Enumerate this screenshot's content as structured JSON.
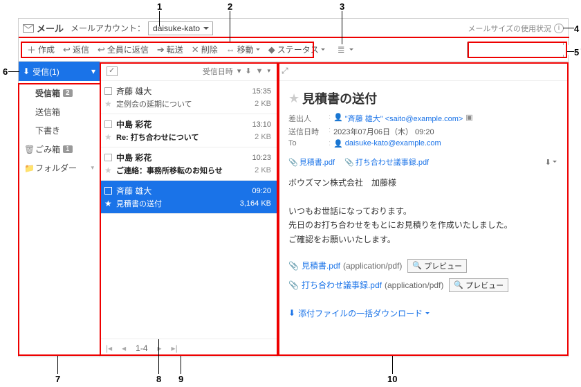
{
  "header": {
    "app_label": "メール",
    "account_label": "メールアカウント：",
    "account_value": "daisuke-kato",
    "usage_label": "メールサイズの使用状況"
  },
  "toolbar": {
    "compose": "作成",
    "reply": "返信",
    "reply_all": "全員に返信",
    "forward": "転送",
    "delete": "削除",
    "move": "移動",
    "status": "ステータス"
  },
  "sidebar": {
    "inbox_head": "受信(1)",
    "folders": [
      {
        "label": "受信箱",
        "badge": "2"
      },
      {
        "label": "送信箱",
        "badge": ""
      },
      {
        "label": "下書き",
        "badge": ""
      },
      {
        "label": "ごみ箱",
        "badge": "1"
      },
      {
        "label": "フォルダー",
        "badge": ""
      }
    ]
  },
  "list": {
    "sort_label": "受信日時",
    "pager": "1-4",
    "messages": [
      {
        "from": "斉藤 雄大",
        "time": "15:35",
        "subject": "定例会の延期について",
        "size": "2 KB",
        "unread": false,
        "selected": false
      },
      {
        "from": "中島 彩花",
        "time": "13:10",
        "subject": "Re: 打ち合わせについて",
        "size": "2 KB",
        "unread": true,
        "selected": false
      },
      {
        "from": "中島 彩花",
        "time": "10:23",
        "subject": "ご連絡：事務所移転のお知らせ",
        "size": "2 KB",
        "unread": true,
        "selected": false
      },
      {
        "from": "斉藤 雄大",
        "time": "09:20",
        "subject": "見積書の送付",
        "size": "3,164 KB",
        "unread": false,
        "selected": true
      }
    ]
  },
  "preview": {
    "subject": "見積書の送付",
    "from_label": "差出人",
    "from_name": "\"斉藤 雄大\" <saito@example.com>",
    "date_label": "送信日時",
    "date_value": "2023年07月06日（木）  09:20",
    "to_label": "To",
    "to_value": "daisuke-kato@example.com",
    "attachments_top": [
      {
        "name": "見積書.pdf"
      },
      {
        "name": "打ち合わせ議事録.pdf"
      }
    ],
    "body_lines": [
      "ボウズマン株式会社　加藤様",
      "",
      "いつもお世話になっております。",
      "先日のお打ち合わせをもとにお見積りを作成いたしました。",
      "ご確認をお願いいたします。"
    ],
    "attachments_full": [
      {
        "name": "見積書.pdf",
        "mime": "(application/pdf)"
      },
      {
        "name": "打ち合わせ議事録.pdf",
        "mime": "(application/pdf)"
      }
    ],
    "preview_btn": "プレビュー",
    "bulk_download": "添付ファイルの一括ダウンロード"
  },
  "callouts": {
    "1": "1",
    "2": "2",
    "3": "3",
    "4": "4",
    "5": "5",
    "6": "6",
    "7": "7",
    "8": "8",
    "9": "9",
    "10": "10"
  }
}
